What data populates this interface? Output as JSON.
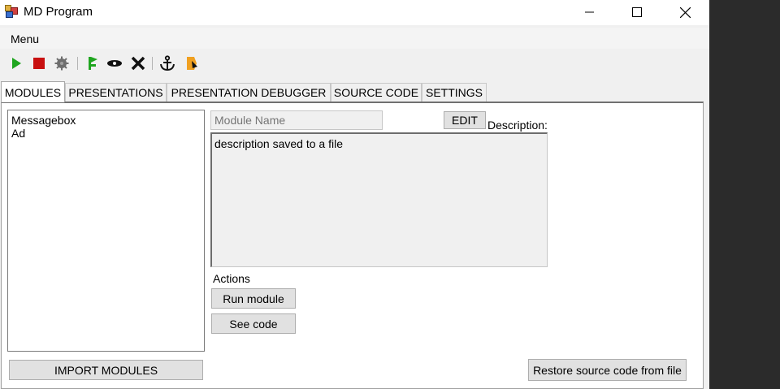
{
  "window": {
    "title": "MD Program",
    "controls": [
      "minimize",
      "maximize",
      "close"
    ]
  },
  "menu": {
    "items": [
      "Menu"
    ]
  },
  "toolbar": {
    "icons": [
      "play-icon",
      "stop-icon",
      "gear-icon",
      "flag-icon",
      "eye-icon",
      "delete-icon",
      "anchor-icon",
      "bookmark-icon"
    ],
    "colors": {
      "play": "#1fa51f",
      "stop": "#c81010",
      "gear": "#6e6e6e",
      "flag": "#1fa51f",
      "bookmark": "#f0a020"
    }
  },
  "tabs": [
    {
      "label": "MODULES",
      "active": true
    },
    {
      "label": "PRESENTATIONS",
      "active": false
    },
    {
      "label": "PRESENTATION DEBUGGER",
      "active": false
    },
    {
      "label": "SOURCE CODE",
      "active": false
    },
    {
      "label": "SETTINGS",
      "active": false
    }
  ],
  "modules": {
    "items": [
      "Messagebox",
      "Ad"
    ],
    "import_button": "IMPORT MODULES"
  },
  "details": {
    "name_placeholder": "Module Name",
    "name_value": "",
    "edit_button": "EDIT",
    "description_label": "Description:",
    "description_text": "description saved to a file",
    "actions_label": "Actions",
    "run_button": "Run module",
    "see_code_button": "See code",
    "restore_button": "Restore source code from file"
  }
}
